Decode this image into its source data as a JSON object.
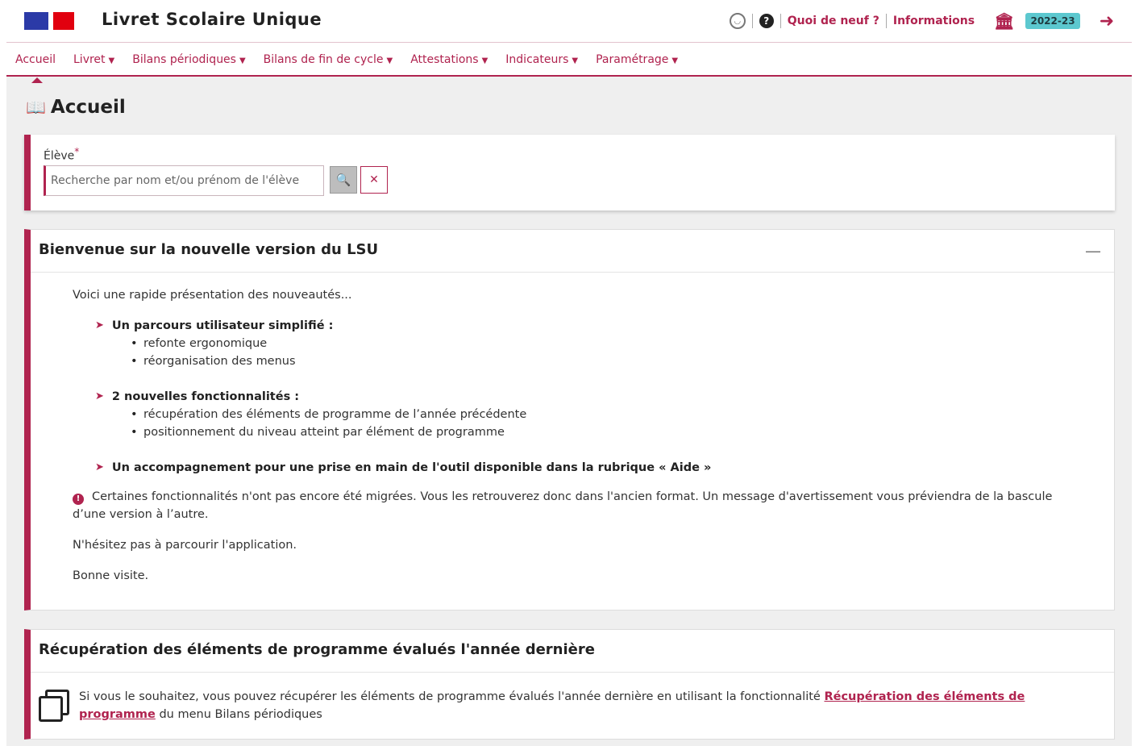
{
  "header": {
    "app_title": "Livret Scolaire Unique",
    "links": {
      "news": "Quoi de neuf ?",
      "info": "Informations"
    },
    "year_badge": "2022-23",
    "colors": {
      "accent": "#b0234f",
      "badge": "#5cc8cf"
    }
  },
  "nav": {
    "items": [
      {
        "label": "Accueil"
      },
      {
        "label": "Livret"
      },
      {
        "label": "Bilans périodiques"
      },
      {
        "label": "Bilans de fin de cycle"
      },
      {
        "label": "Attestations"
      },
      {
        "label": "Indicateurs"
      },
      {
        "label": "Paramétrage"
      }
    ]
  },
  "page": {
    "title": "Accueil"
  },
  "search": {
    "label": "Élève",
    "required_mark": "*",
    "placeholder": "Recherche par nom et/ou prénom de l'élève"
  },
  "welcome": {
    "title": "Bienvenue sur la nouvelle version du LSU",
    "collapse": "—",
    "intro": "Voici une rapide présentation des nouveautés...",
    "features": [
      {
        "title": "Un parcours utilisateur simplifié :",
        "items": [
          "refonte ergonomique",
          "réorganisation des menus"
        ]
      },
      {
        "title": "2 nouvelles fonctionnalités :",
        "items": [
          "récupération des éléments de programme de l’année précédente",
          "positionnement du niveau atteint par élément de programme"
        ]
      },
      {
        "title": "Un accompagnement pour une prise en main de l'outil disponible dans la rubrique « Aide »",
        "items": []
      }
    ],
    "notice": "Certaines fonctionnalités n'ont pas encore été migrées. Vous les retrouverez donc dans l'ancien format. Un message d'avertissement vous préviendra de la bascule d’une version à l’autre.",
    "para1": "N'hésitez pas à parcourir l'application.",
    "para2": "Bonne visite."
  },
  "recover": {
    "title": "Récupération des éléments de programme évalués l'année dernière",
    "text_before": "Si vous le souhaitez, vous pouvez récupérer les éléments de programme évalués l'année dernière en utilisant la fonctionnalité ",
    "link": "Récupération des éléments de programme",
    "text_after": " du menu Bilans périodiques"
  },
  "icons": [
    "headset-icon",
    "question-icon",
    "bank-icon",
    "logout-icon",
    "book-icon",
    "search-icon",
    "close-icon",
    "info-icon",
    "copy-icon",
    "chevron-right-icon"
  ]
}
